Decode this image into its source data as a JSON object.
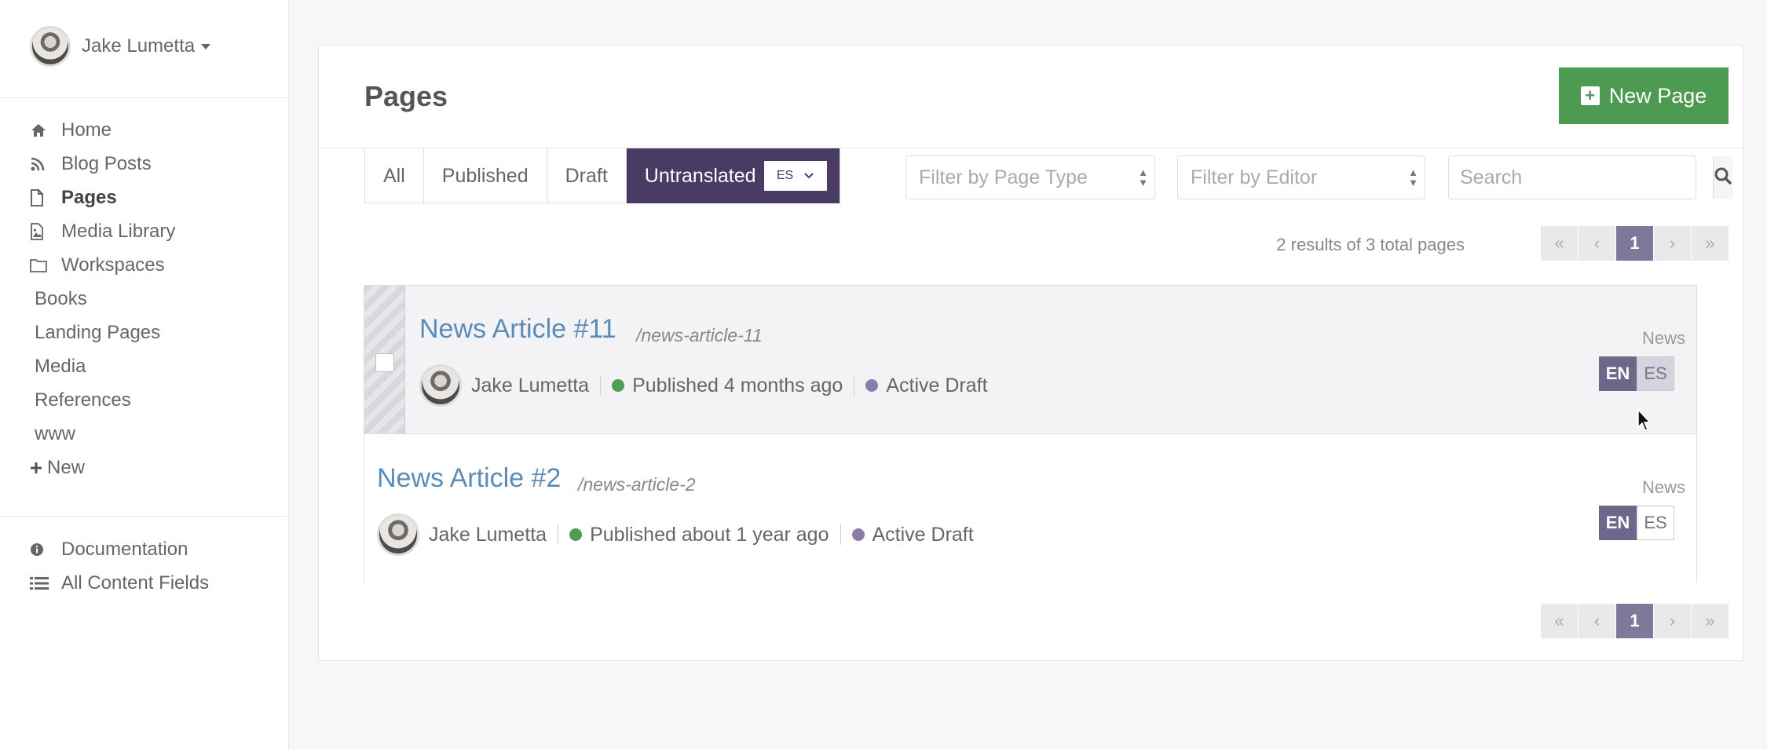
{
  "user": {
    "name": "Jake Lumetta"
  },
  "nav": {
    "primary": [
      {
        "label": "Home",
        "icon": "home-icon"
      },
      {
        "label": "Blog Posts",
        "icon": "rss-icon"
      },
      {
        "label": "Pages",
        "icon": "file-icon",
        "active": true
      },
      {
        "label": "Media Library",
        "icon": "image-icon"
      },
      {
        "label": "Workspaces",
        "icon": "folder-icon"
      }
    ],
    "secondary": [
      "Books",
      "Landing Pages",
      "Media",
      "References",
      "www"
    ],
    "new_label": "New",
    "footer": [
      {
        "label": "Documentation",
        "icon": "info-icon"
      },
      {
        "label": "All Content Fields",
        "icon": "list-icon"
      }
    ]
  },
  "main": {
    "title": "Pages",
    "new_button": "New Page",
    "tabs": [
      "All",
      "Published",
      "Draft",
      "Untranslated"
    ],
    "tab_lang": "ES",
    "filter_page_type": "Filter by Page Type",
    "filter_editor": "Filter by Editor",
    "search_placeholder": "Search",
    "results_text": "2 results of 3 total pages",
    "pager": {
      "first": "«",
      "prev": "‹",
      "current": "1",
      "next": "›",
      "last": "»"
    }
  },
  "articles": [
    {
      "title": "News Article #11",
      "slug": "/news-article-11",
      "author": "Jake Lumetta",
      "published": "Published 4 months ago",
      "draft": "Active Draft",
      "type": "News",
      "langs": [
        "EN",
        "ES"
      ]
    },
    {
      "title": "News Article #2",
      "slug": "/news-article-2",
      "author": "Jake Lumetta",
      "published": "Published about 1 year ago",
      "draft": "Active Draft",
      "type": "News",
      "langs": [
        "EN",
        "ES"
      ]
    }
  ],
  "colors": {
    "accent": "#4a3b64",
    "new_button": "#4d9a52",
    "link": "#5a8cba",
    "published": "#4f9c55",
    "draft": "#8a7ea8"
  }
}
